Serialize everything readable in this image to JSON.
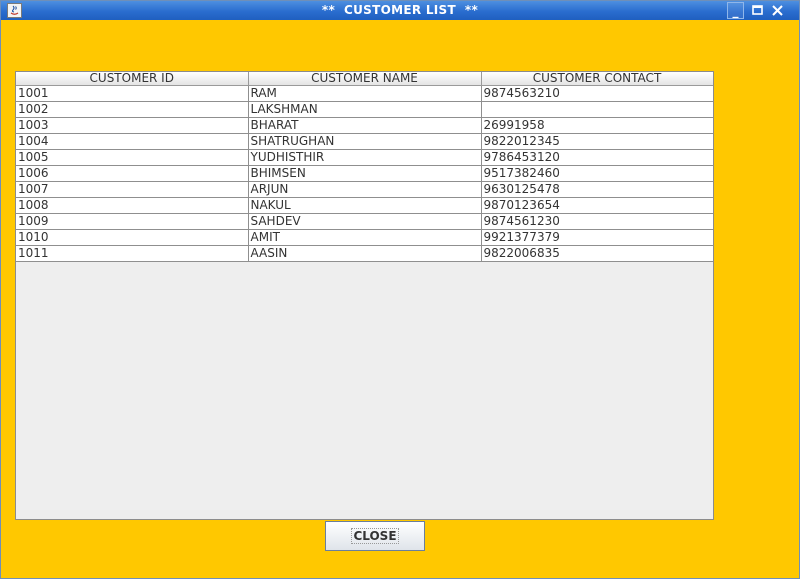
{
  "window": {
    "title": "**  CUSTOMER LIST  **",
    "controls": {
      "minimize": "_",
      "maximize": "▫",
      "close": "✕"
    }
  },
  "table": {
    "headers": [
      "CUSTOMER ID",
      "CUSTOMER NAME",
      "CUSTOMER CONTACT"
    ],
    "rows": [
      [
        "1001",
        "RAM",
        "9874563210"
      ],
      [
        "1002",
        "LAKSHMAN",
        ""
      ],
      [
        "1003",
        "BHARAT",
        "26991958"
      ],
      [
        "1004",
        "SHATRUGHAN",
        "9822012345"
      ],
      [
        "1005",
        "YUDHISTHIR",
        "9786453120"
      ],
      [
        "1006",
        "BHIMSEN",
        "9517382460"
      ],
      [
        "1007",
        "ARJUN",
        "9630125478"
      ],
      [
        "1008",
        "NAKUL",
        "9870123654"
      ],
      [
        "1009",
        "SAHDEV",
        "9874561230"
      ],
      [
        "1010",
        "AMIT",
        "9921377379"
      ],
      [
        "1011",
        "AASIN",
        "9822006835"
      ]
    ]
  },
  "buttons": {
    "close_label": "CLOSE"
  },
  "colors": {
    "background": "#ffc800",
    "titlebar": "#2a6dcf",
    "panel": "#eeeeee"
  }
}
